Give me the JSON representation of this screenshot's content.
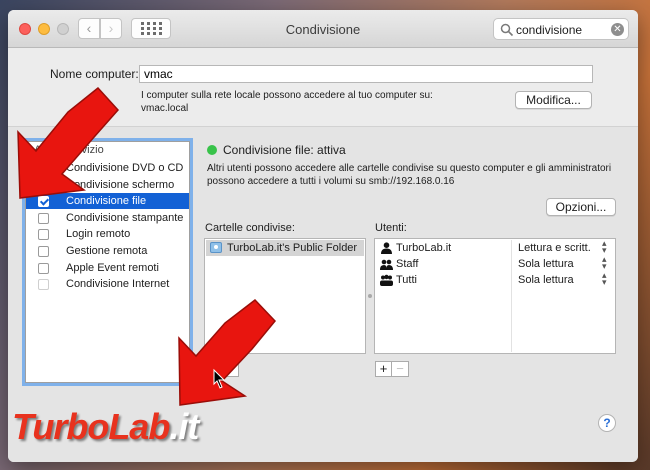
{
  "window": {
    "title": "Condivisione",
    "search": {
      "value": "condivisione"
    }
  },
  "computer": {
    "label": "Nome computer:",
    "name": "vmac",
    "info_line1": "I computer sulla rete locale possono accedere al tuo computer su:",
    "info_line2": "vmac.local",
    "edit_button": "Modifica..."
  },
  "services": {
    "header": "Attiva Servizio",
    "items": [
      {
        "label": "Condivisione DVD o CD",
        "checked": false,
        "selected": false
      },
      {
        "label": "Condivisione schermo",
        "checked": false,
        "selected": false
      },
      {
        "label": "Condivisione file",
        "checked": true,
        "selected": true
      },
      {
        "label": "Condivisione stampante",
        "checked": false,
        "selected": false
      },
      {
        "label": "Login remoto",
        "checked": false,
        "selected": false
      },
      {
        "label": "Gestione remota",
        "checked": false,
        "selected": false
      },
      {
        "label": "Apple Event remoti",
        "checked": false,
        "selected": false
      },
      {
        "label": "Condivisione Internet",
        "checked": false,
        "selected": false
      }
    ]
  },
  "file_sharing": {
    "status": "Condivisione file: attiva",
    "status_color": "#38c34a",
    "desc_line1": "Altri utenti possono accedere alle cartelle condivise su questo computer e gli amministratori",
    "desc_line2": "possono accedere a tutti i volumi su smb://192.168.0.16",
    "options_button": "Opzioni...",
    "folders_header": "Cartelle condivise:",
    "folders": [
      "TurboLab.it's Public Folder"
    ],
    "users_header": "Utenti:",
    "users": [
      {
        "name": "TurboLab.it",
        "permission": "Lettura e scritt.",
        "icon": "user-icon"
      },
      {
        "name": "Staff",
        "permission": "Sola lettura",
        "icon": "group-icon"
      },
      {
        "name": "Tutti",
        "permission": "Sola lettura",
        "icon": "everyone-icon"
      }
    ],
    "add": "+",
    "remove": "−"
  },
  "help": "?",
  "watermark": {
    "part1": "TurboLab",
    "part2": ".it"
  },
  "colors": {
    "accent": "#1361d5",
    "arrow": "#e8150f"
  }
}
